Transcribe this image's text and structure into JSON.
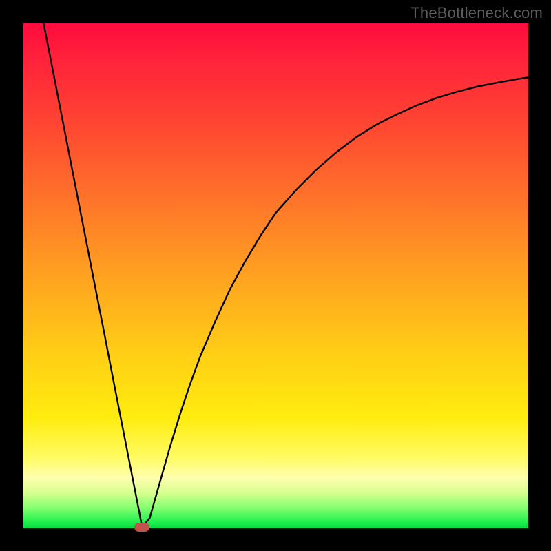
{
  "attribution": "TheBottleneck.com",
  "chart_data": {
    "type": "line",
    "title": "",
    "xlabel": "",
    "ylabel": "",
    "xlim": [
      0,
      100
    ],
    "ylim": [
      0,
      100
    ],
    "series": [
      {
        "name": "curve",
        "x": [
          4,
          6,
          8,
          10,
          12,
          14,
          16,
          18,
          20,
          22,
          23.5,
          25,
          27,
          29,
          31,
          33,
          35,
          38,
          41,
          44,
          47,
          50,
          54,
          58,
          62,
          66,
          70,
          74,
          78,
          82,
          86,
          90,
          94,
          98,
          100
        ],
        "values": [
          100,
          89.8,
          79.6,
          69.3,
          59.1,
          48.9,
          38.7,
          28.4,
          18.2,
          8.0,
          0.3,
          2.0,
          9.0,
          16.0,
          22.5,
          28.5,
          34.0,
          41.0,
          47.5,
          53.0,
          58.0,
          62.5,
          67.0,
          71.0,
          74.5,
          77.5,
          80.0,
          82.0,
          83.8,
          85.3,
          86.5,
          87.5,
          88.3,
          89.0,
          89.3
        ]
      }
    ],
    "marker": {
      "x": 23.5,
      "y": 0.3
    },
    "background_gradient": {
      "top": "#ff0a3e",
      "mid": "#ffd015",
      "bottom": "#0dd640"
    }
  },
  "colors": {
    "curve": "#000000",
    "marker": "#c1524c"
  }
}
